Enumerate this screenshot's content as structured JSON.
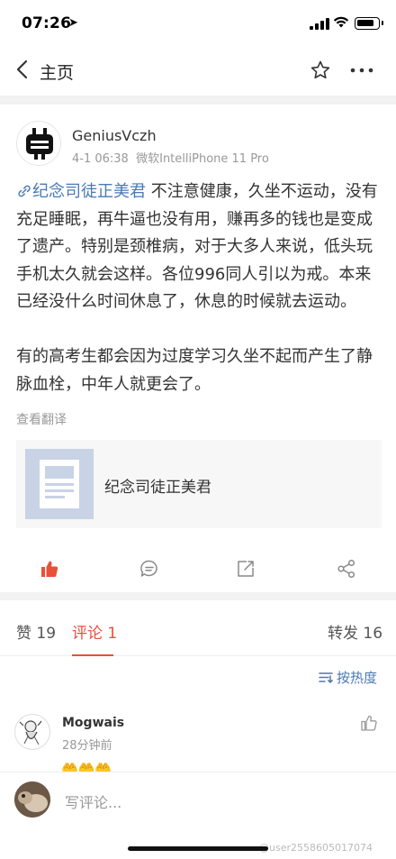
{
  "status_bar": {
    "time": "07:26",
    "location_icon": "location-arrow-icon",
    "signal_icon": "cellular-signal-icon",
    "wifi_icon": "wifi-icon",
    "battery_icon": "battery-icon"
  },
  "nav": {
    "back_icon": "chevron-left-icon",
    "title": "主页",
    "favorite_icon": "star-outline-icon",
    "more_icon": "more-dots-icon"
  },
  "post": {
    "author": "GeniusVczh",
    "time": "4-1 06:38",
    "source": "微软IntelliPhone 11 Pro",
    "link_text": "纪念司徒正美君",
    "paragraph1_rest": " 不注意健康，久坐不运动，没有充足睡眠，再牛逼也没有用，赚再多的钱也是变成了遗产。特别是颈椎病，对于大多人来说，低头玩手机太久就会这样。各位996同人引以为戒。本来已经没什么时间休息了，休息的时候就去运动。",
    "paragraph2": "有的高考生都会因为过度学习久坐不起而产生了静脉血栓，中年人就更会了。",
    "translate": "查看翻译",
    "card_title": "纪念司徒正美君"
  },
  "actions": {
    "like_icon": "thumbs-up-filled-icon",
    "comment_icon": "comment-bubble-icon",
    "share_icon": "external-share-icon",
    "more_share_icon": "share-nodes-icon"
  },
  "tabs": {
    "likes": "赞 19",
    "comments": "评论 1",
    "reposts": "转发 16"
  },
  "sort_label": "按热度",
  "comment": {
    "author": "Mogwais",
    "time": "28分钟前",
    "emojis": "🤲🤲🤲"
  },
  "composer": {
    "placeholder": "写评论..."
  },
  "watermark": "@user2558605017074",
  "colors": {
    "accent": "#e8503a",
    "link": "#4a7ab5"
  }
}
